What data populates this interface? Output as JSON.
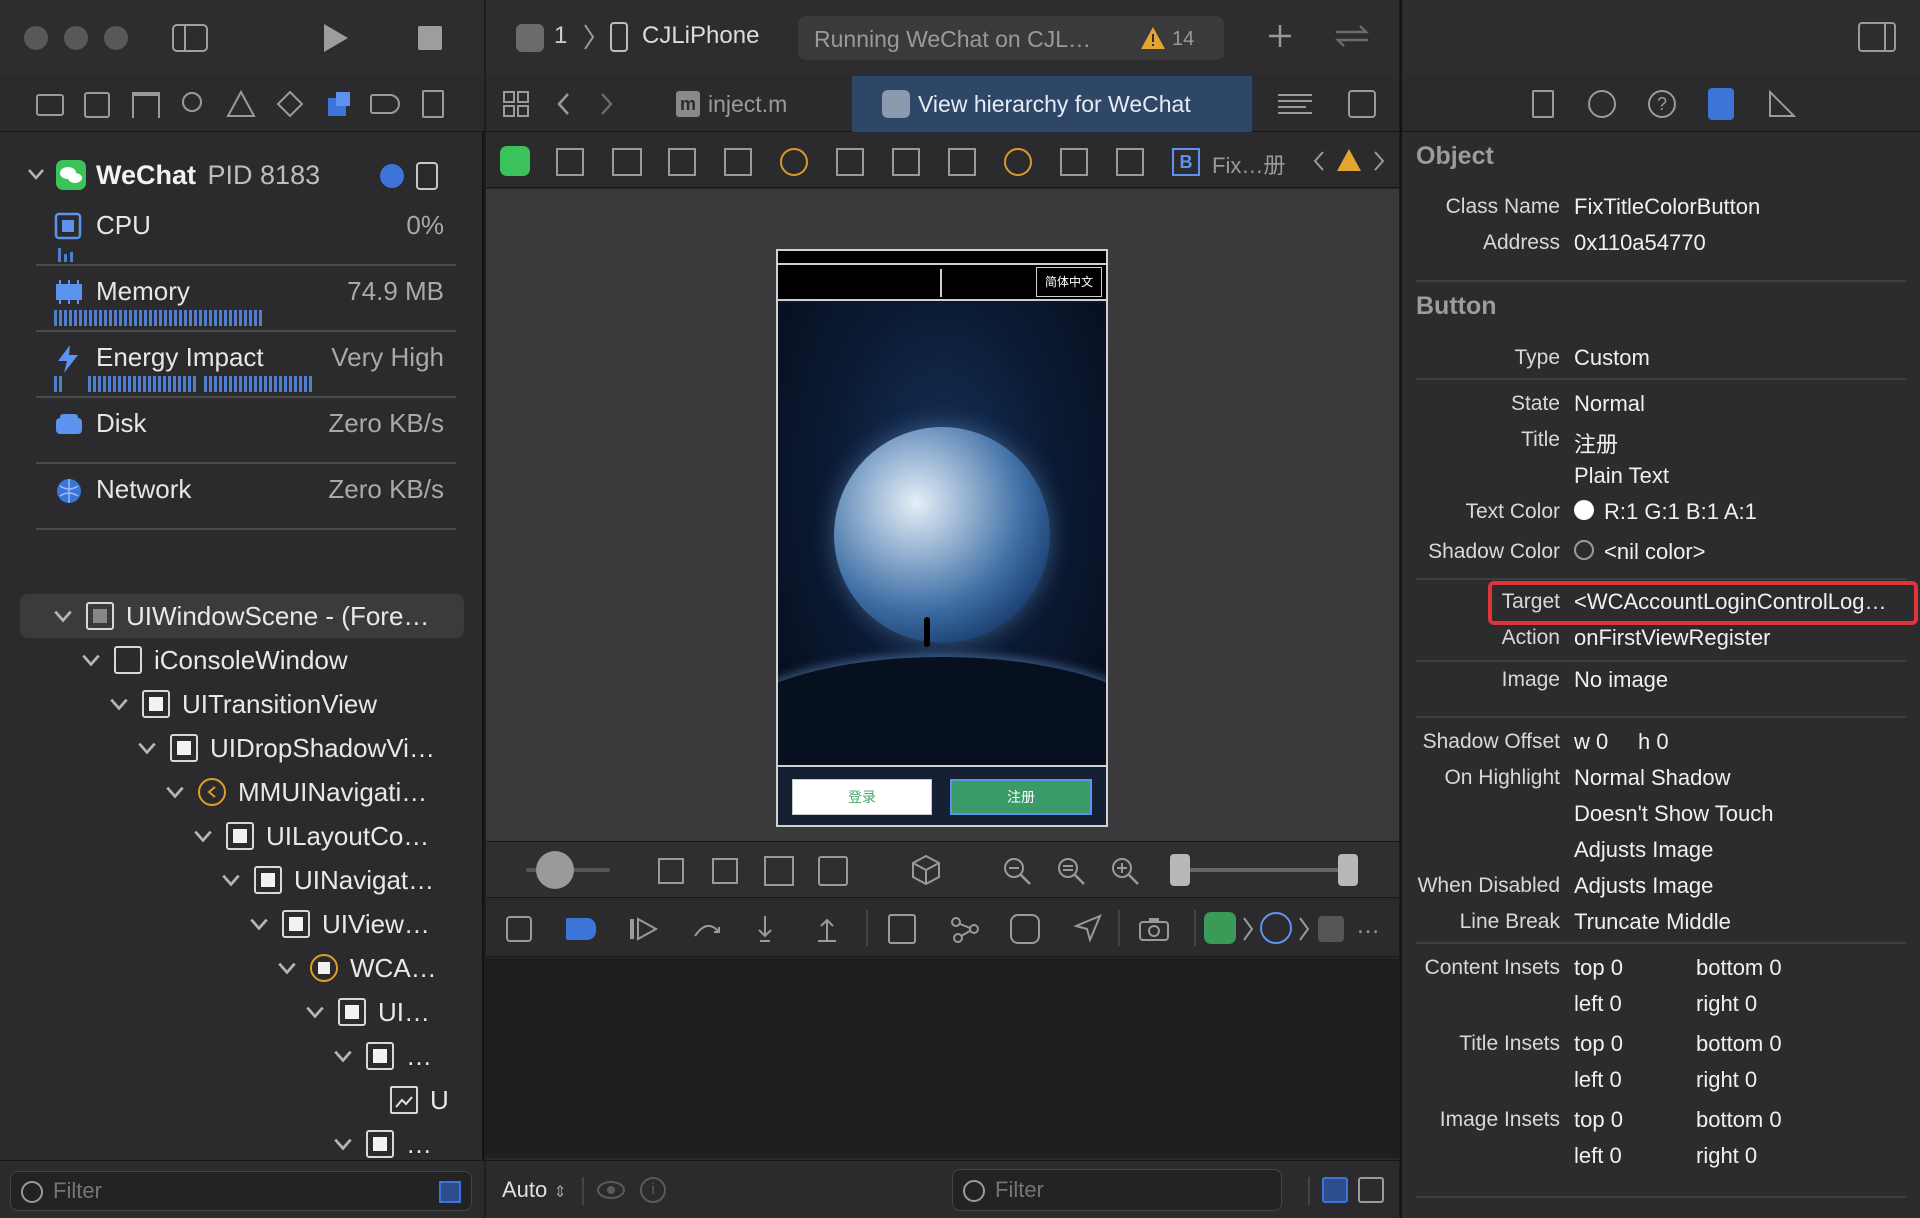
{
  "left": {
    "process": {
      "name": "WeChat",
      "pid": "PID 8183"
    },
    "gauges": [
      {
        "label": "CPU",
        "value": "0%",
        "icon": "cpu-icon"
      },
      {
        "label": "Memory",
        "value": "74.9 MB",
        "icon": "memory-icon"
      },
      {
        "label": "Energy Impact",
        "value": "Very High",
        "icon": "energy-icon"
      },
      {
        "label": "Disk",
        "value": "Zero KB/s",
        "icon": "disk-icon"
      },
      {
        "label": "Network",
        "value": "Zero KB/s",
        "icon": "network-icon"
      }
    ],
    "tree": [
      "UIWindowScene - (Fore…",
      "iConsoleWindow",
      "UITransitionView",
      "UIDropShadowVi…",
      "MMUINavigati…",
      "UILayoutCo…",
      "UINavigat…",
      "UIView…",
      "WCA…",
      "UI…",
      "…",
      "U",
      "…"
    ],
    "filter_placeholder": "Filter"
  },
  "toolbar": {
    "scheme_number": "1",
    "device": "CJLiPhone",
    "status": "Running WeChat on CJL…",
    "warnings": "14"
  },
  "tabs": [
    {
      "label": "inject.m"
    },
    {
      "label": "View hierarchy for WeChat"
    }
  ],
  "jumpbar": {
    "last": "Fix…册"
  },
  "canvas": {
    "language_button": "简体中文",
    "login_button": "登录",
    "register_button": "注册",
    "colors": {
      "register": "#3a9a68",
      "login_text": "#4aa86e"
    }
  },
  "debug_bar": {
    "auto_label": "Auto",
    "filter_placeholder": "Filter"
  },
  "inspector": {
    "object": {
      "title": "Object",
      "class_name_label": "Class Name",
      "class_name": "FixTitleColorButton",
      "address_label": "Address",
      "address": "0x110a54770"
    },
    "button": {
      "title": "Button",
      "type_label": "Type",
      "type": "Custom",
      "state_label": "State",
      "state": "Normal",
      "title_label": "Title",
      "title_value": "注册",
      "title_kind": "Plain Text",
      "text_color_label": "Text Color",
      "text_color": "R:1 G:1 B:1 A:1",
      "shadow_color_label": "Shadow Color",
      "shadow_color": "<nil color>",
      "target_label": "Target",
      "target": "<WCAccountLoginControlLog…",
      "action_label": "Action",
      "action": "onFirstViewRegister",
      "image_label": "Image",
      "image": "No image",
      "shadow_offset_label": "Shadow Offset",
      "shadow_w": "w  0",
      "shadow_h": "h  0",
      "on_highlight_label": "On Highlight",
      "on_highlight": "Normal Shadow",
      "doesnt_show_touch": "Doesn't Show Touch",
      "adjusts_image": "Adjusts Image",
      "when_disabled_label": "When Disabled",
      "when_disabled": "Adjusts Image",
      "line_break_label": "Line Break",
      "line_break": "Truncate Middle",
      "content_insets_label": "Content Insets",
      "title_insets_label": "Title Insets",
      "image_insets_label": "Image Insets",
      "insets": {
        "top": "top  0",
        "bottom": "bottom  0",
        "left": "left  0",
        "right": "right  0"
      },
      "highlight_color": "#e0343b"
    }
  }
}
